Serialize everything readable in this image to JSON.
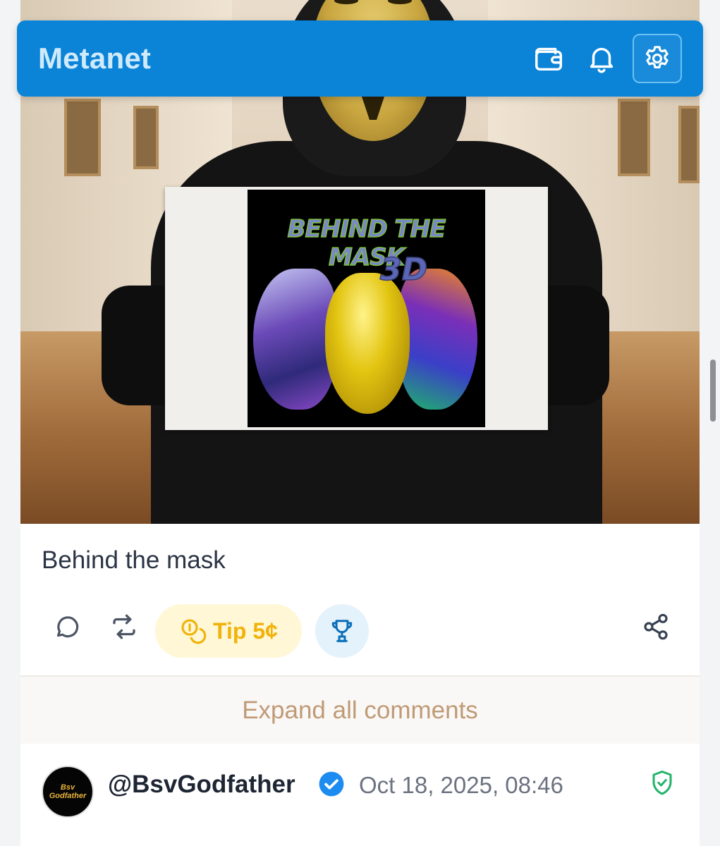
{
  "app": {
    "title": "Metanet"
  },
  "header": {
    "icons": [
      "wallet-icon",
      "bell-icon",
      "settings-icon"
    ],
    "colors": {
      "bar": "#0b84d8",
      "title": "#cfeafb"
    }
  },
  "post": {
    "image": {
      "sign_title": "BEHIND THE MASK",
      "sign_subtitle": "3D"
    },
    "text": "Behind the mask",
    "actions": {
      "tip_label": "Tip 5¢",
      "icons": [
        "comment-icon",
        "repost-icon",
        "coins-icon",
        "trophy-icon",
        "share-icon"
      ]
    }
  },
  "comments": {
    "expand_label": "Expand all comments",
    "items": [
      {
        "avatar_text_line1": "Bsv",
        "avatar_text_line2": "Godfather",
        "username": "@BsvGodfather",
        "verified": true,
        "timestamp": "Oct 18, 2025, 08:46",
        "status_icon": "shield-check-icon"
      }
    ]
  },
  "colors": {
    "tip": "#f1b30a",
    "expand": "#bf9a76",
    "verified": "#1d8cf0",
    "shield": "#22b36a"
  }
}
